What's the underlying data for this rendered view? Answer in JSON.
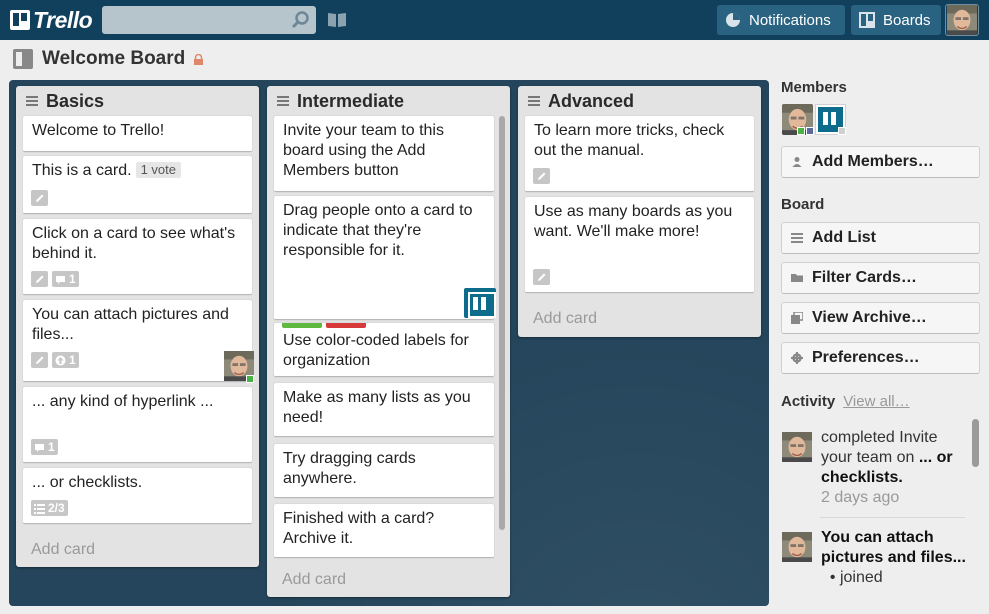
{
  "header": {
    "logo_text": "Trello",
    "search_placeholder": "",
    "notifications_label": "Notifications",
    "boards_label": "Boards"
  },
  "board": {
    "title": "Welcome Board"
  },
  "lists": [
    {
      "title": "Basics",
      "add_card": "Add card",
      "cards": [
        {
          "text": "Welcome to Trello!"
        },
        {
          "text": "This is a card.",
          "vote": "1 vote"
        },
        {
          "text": "Click on a card to see what's behind it.",
          "comments": "1"
        },
        {
          "text": "You can attach pictures and files...",
          "attachments": "1"
        },
        {
          "text": "... any kind of hyperlink ...",
          "comments": "1"
        },
        {
          "text": "... or checklists.",
          "checklist": "2/3"
        }
      ]
    },
    {
      "title": "Intermediate",
      "add_card": "Add card",
      "cards": [
        {
          "text": "Invite your team to this board using the Add Members button"
        },
        {
          "text": "Drag people onto a card to indicate that they're responsible for it."
        },
        {
          "text": "Use color-coded labels for organization",
          "labels": [
            "#5fb940",
            "#d63a3a"
          ]
        },
        {
          "text": "Make as many lists as you need!"
        },
        {
          "text": "Try dragging cards anywhere."
        },
        {
          "text": "Finished with a card? Archive it."
        }
      ]
    },
    {
      "title": "Advanced",
      "add_card": "Add card",
      "cards": [
        {
          "text": "To learn more tricks, check out the manual."
        },
        {
          "text": "Use as many boards as you want. We'll make more!"
        }
      ]
    }
  ],
  "sidebar": {
    "members_heading": "Members",
    "add_members": "Add Members…",
    "board_heading": "Board",
    "add_list": "Add List",
    "filter_cards": "Filter Cards…",
    "view_archive": "View Archive…",
    "preferences": "Preferences…",
    "activity_heading": "Activity",
    "view_all": "View all…",
    "activity": [
      {
        "prefix": "completed Invite your team on",
        "target": "... or checklists.",
        "time": "2 days ago"
      },
      {
        "target": "You can attach pictures and files...",
        "bullet": "joined"
      }
    ]
  },
  "colors": {
    "header": "#10405c",
    "canvas": "#24455b",
    "list": "#e3e3e3",
    "label_green": "#5fb940",
    "label_red": "#d63a3a",
    "member_green": "#4ab344"
  }
}
